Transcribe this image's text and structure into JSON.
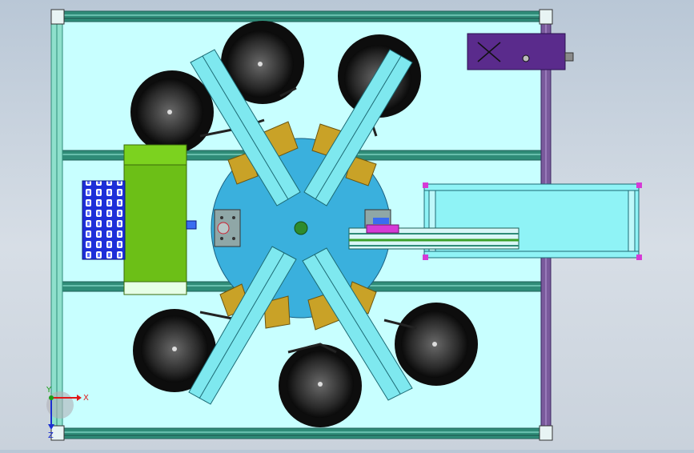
{
  "viewport": {
    "background_top": "#b9c7d6",
    "background_bottom": "#d7dee6"
  },
  "colors": {
    "frame_fill": "#c8ffff",
    "frame_rail": "#2f8c78",
    "rail_dark": "#1f5f57",
    "turntable": "#3ab0dd",
    "hub": "#2e8b2e",
    "vibratory_bowl_dark": "#0d0d0d",
    "vibratory_bowl_face": "#4a4a4a",
    "feed_track": "#7ee8ef",
    "bracket": "#c9a227",
    "tray_blue": "#1e2fd8",
    "green_block": "#6cbf17",
    "purple_box": "#5a2b8c",
    "conveyor": "#8ff3f6",
    "magenta_clamp": "#d53ad6",
    "vertical_rail_purple": "#7a5a9c"
  },
  "triad": {
    "x_label": "X",
    "y_label": "Y",
    "z_label": "Z",
    "x_color": "#e01818",
    "y_color": "#18a018",
    "z_color": "#1a2fd0"
  },
  "icons": {
    "triad": "coordinate-triad-icon",
    "cross": "x-mark-icon"
  }
}
